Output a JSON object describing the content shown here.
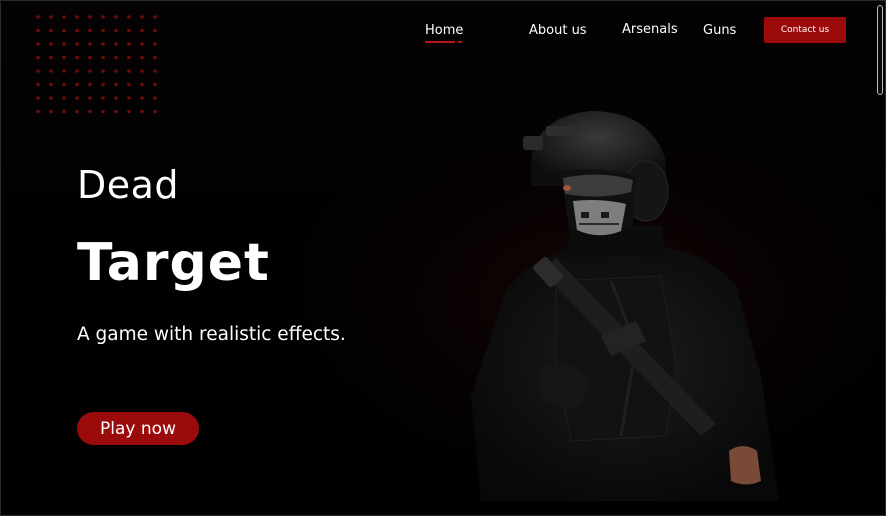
{
  "nav": {
    "items": [
      {
        "label": "Home",
        "active": true
      },
      {
        "label": "About us"
      },
      {
        "label": "Arsenals"
      },
      {
        "label": "Guns"
      }
    ],
    "contact_label": "Contact us"
  },
  "hero": {
    "line1": "Dead",
    "line2": "Target",
    "tagline": "A game with realistic effects.",
    "cta_label": "Play now"
  },
  "colors": {
    "accent": "#9b0b0b",
    "background": "#000000",
    "text": "#ffffff",
    "dot_grid": "#6e0c0c"
  },
  "icons": [
    "dot-grid-decoration",
    "soldier-image"
  ]
}
